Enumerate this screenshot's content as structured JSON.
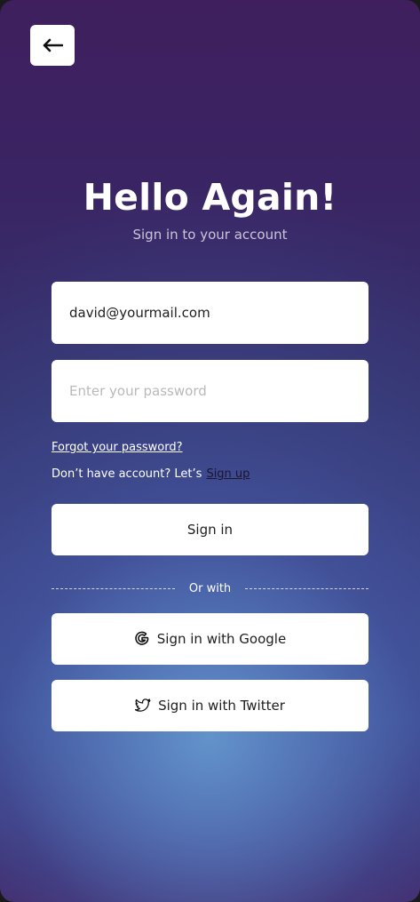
{
  "header": {
    "back_icon": "arrow-left-icon"
  },
  "title": "Hello Again!",
  "subtitle": "Sign in to your account",
  "form": {
    "email_value": "david@yourmail.com",
    "password_placeholder": "Enter your password",
    "forgot_label": "Forgot your password?",
    "signup_prompt": "Don’t have account? Let’s",
    "signup_label": "Sign up",
    "signin_label": "Sign in"
  },
  "divider": {
    "label": "Or with"
  },
  "social": {
    "google_label": "Sign in with Google",
    "google_icon": "google-icon",
    "twitter_label": "Sign in with Twitter",
    "twitter_icon": "twitter-icon"
  },
  "colors": {
    "background_top": "#3f1f5e",
    "background_glow": "#6496cd",
    "surface": "#ffffff",
    "text_dark": "#1e1e1e"
  }
}
